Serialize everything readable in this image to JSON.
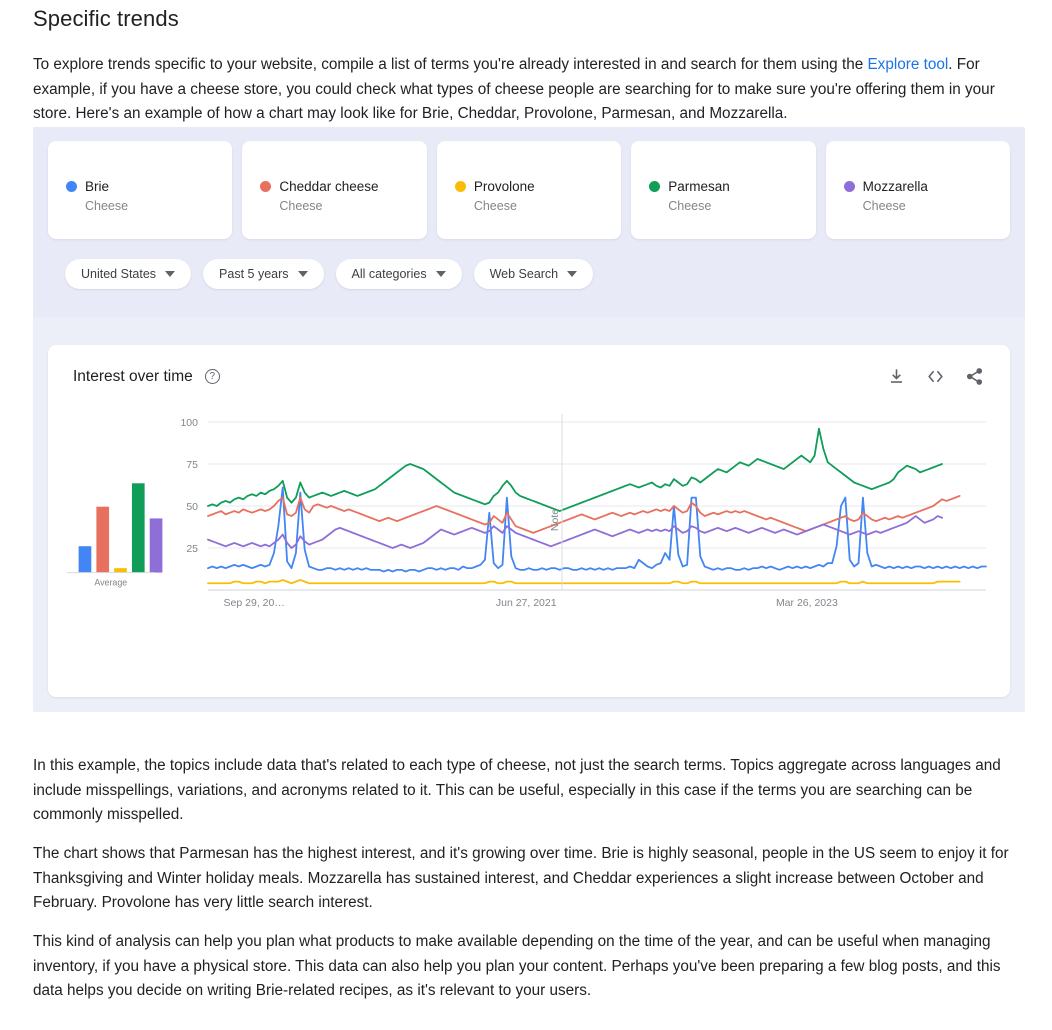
{
  "document": {
    "heading": "Specific trends",
    "paragraphs": [
      {
        "id": "p1",
        "before_link": "To explore trends specific to your website, compile a list of terms you're already interested in and search for them using the ",
        "link_text": "Explore tool",
        "after_link": ". For example, if you have a cheese store, you could check what types of cheese people are searching for to make sure you're offering them in your store. Here's an example of how a chart may look like for Brie, Cheddar, Provolone, Parmesan, and Mozzarella."
      },
      {
        "id": "p2",
        "text": "In this example, the topics include data that's related to each type of cheese, not just the search terms. Topics aggregate across languages and include misspellings, variations, and acronyms related to it. This can be useful, especially in this case if the terms you are searching can be commonly misspelled."
      },
      {
        "id": "p3",
        "text": "The chart shows that Parmesan has the highest interest, and it's growing over time. Brie is highly seasonal, people in the US seem to enjoy it for Thanksgiving and Winter holiday meals. Mozzarella has sustained interest, and Cheddar experiences a slight increase between October and February. Provolone has very little search interest."
      },
      {
        "id": "p4",
        "text": "This kind of analysis can help you plan what products to make available depending on the time of the year, and can be useful when managing inventory, if you have a physical store. This data can also help you plan your content. Perhaps you've been preparing a few blog posts, and this data helps you decide on writing Brie-related recipes, as it's relevant to your users."
      }
    ]
  },
  "trends_widget": {
    "terms": [
      {
        "name": "Brie",
        "subtitle": "Cheese",
        "color": "#4285f4"
      },
      {
        "name": "Cheddar cheese",
        "subtitle": "Cheese",
        "color": "#e8705f"
      },
      {
        "name": "Provolone",
        "subtitle": "Cheese",
        "color": "#fbbc04"
      },
      {
        "name": "Parmesan",
        "subtitle": "Cheese",
        "color": "#0f9d58"
      },
      {
        "name": "Mozzarella",
        "subtitle": "Cheese",
        "color": "#8e6fd8"
      }
    ],
    "filters": [
      {
        "label": "United States",
        "name": "region"
      },
      {
        "label": "Past 5 years",
        "name": "time-range"
      },
      {
        "label": "All categories",
        "name": "category"
      },
      {
        "label": "Web Search",
        "name": "search-type"
      }
    ],
    "chart_card": {
      "title": "Interest over time",
      "help_icon": "help-circle-icon",
      "actions": [
        {
          "name": "download-icon",
          "label": "Download"
        },
        {
          "name": "embed-code-icon",
          "label": "Embed"
        },
        {
          "name": "share-icon",
          "label": "Share"
        }
      ],
      "note_label": "Note"
    }
  },
  "chart_data": {
    "type": "line",
    "title": "Interest over time",
    "xlabel": "",
    "ylabel": "",
    "ylim": [
      0,
      100
    ],
    "yticks": [
      25,
      50,
      75,
      100
    ],
    "xticks": [
      "Sep 29, 20…",
      "Jun 27, 2021",
      "Mar 26, 2023"
    ],
    "grid": true,
    "legend_position": "top-cards",
    "annotations": [
      {
        "label": "Note",
        "x_fraction": 0.455,
        "type": "vertical-marker"
      }
    ],
    "average_chart": {
      "type": "bar",
      "title": "Average",
      "categories": [
        "Brie",
        "Cheddar cheese",
        "Provolone",
        "Parmesan",
        "Mozzarella"
      ],
      "values": [
        18,
        45,
        3,
        61,
        37
      ],
      "ylim": [
        0,
        100
      ]
    },
    "series": [
      {
        "name": "Brie",
        "color": "#4285f4",
        "values": [
          13,
          14,
          13,
          14,
          13,
          14,
          15,
          14,
          15,
          14,
          13,
          14,
          15,
          14,
          15,
          22,
          38,
          61,
          17,
          13,
          22,
          58,
          24,
          14,
          13,
          12,
          12,
          13,
          13,
          12,
          13,
          12,
          13,
          12,
          13,
          12,
          13,
          12,
          12,
          12,
          11,
          12,
          11,
          12,
          12,
          11,
          12,
          12,
          11,
          12,
          13,
          13,
          12,
          13,
          12,
          13,
          13,
          12,
          14,
          13,
          13,
          14,
          15,
          18,
          46,
          16,
          13,
          15,
          55,
          20,
          13,
          12,
          12,
          13,
          12,
          12,
          13,
          12,
          13,
          13,
          12,
          13,
          13,
          12,
          12,
          13,
          12,
          13,
          12,
          13,
          12,
          13,
          12,
          13,
          13,
          13,
          14,
          13,
          18,
          16,
          14,
          13,
          15,
          16,
          22,
          18,
          50,
          21,
          14,
          15,
          55,
          55,
          20,
          14,
          13,
          12,
          13,
          12,
          13,
          13,
          12,
          12,
          13,
          12,
          13,
          13,
          14,
          13,
          14,
          13,
          12,
          13,
          14,
          13,
          14,
          13,
          14,
          13,
          14,
          15,
          14,
          16,
          16,
          26,
          50,
          55,
          18,
          14,
          16,
          55,
          22,
          14,
          15,
          14,
          13,
          14,
          13,
          14,
          13,
          14,
          13,
          14,
          14,
          13,
          14,
          13,
          14,
          13,
          14,
          13,
          14,
          13,
          14,
          13,
          14,
          13,
          14,
          14
        ]
      },
      {
        "name": "Cheddar cheese",
        "color": "#e8705f",
        "values": [
          44,
          45,
          46,
          47,
          45,
          46,
          47,
          46,
          48,
          47,
          46,
          47,
          48,
          47,
          48,
          50,
          53,
          55,
          45,
          44,
          46,
          55,
          48,
          46,
          50,
          51,
          50,
          49,
          50,
          49,
          48,
          47,
          48,
          47,
          46,
          45,
          44,
          43,
          42,
          41,
          42,
          43,
          42,
          41,
          42,
          43,
          44,
          45,
          46,
          47,
          48,
          49,
          50,
          49,
          48,
          47,
          46,
          45,
          44,
          43,
          42,
          41,
          40,
          39,
          40,
          44,
          42,
          40,
          46,
          42,
          38,
          37,
          36,
          35,
          34,
          35,
          36,
          37,
          38,
          39,
          40,
          41,
          42,
          43,
          44,
          45,
          44,
          43,
          42,
          43,
          44,
          45,
          46,
          45,
          44,
          45,
          46,
          45,
          46,
          47,
          46,
          47,
          48,
          47,
          48,
          47,
          50,
          48,
          46,
          47,
          52,
          50,
          46,
          44,
          45,
          46,
          45,
          46,
          47,
          46,
          47,
          46,
          47,
          46,
          45,
          44,
          43,
          42,
          43,
          42,
          41,
          40,
          39,
          38,
          37,
          36,
          35,
          36,
          37,
          38,
          39,
          40,
          41,
          42,
          43,
          44,
          42,
          41,
          42,
          46,
          44,
          42,
          41,
          42,
          43,
          42,
          43,
          44,
          43,
          44,
          45,
          46,
          47,
          48,
          49,
          50,
          52,
          54,
          53,
          54,
          55,
          56
        ]
      },
      {
        "name": "Provolone",
        "color": "#fbbc04",
        "values": [
          4,
          4,
          4,
          4,
          4,
          4,
          5,
          5,
          4,
          4,
          4,
          5,
          5,
          4,
          5,
          5,
          5,
          6,
          5,
          4,
          5,
          6,
          5,
          4,
          4,
          4,
          4,
          4,
          4,
          4,
          4,
          4,
          4,
          4,
          4,
          4,
          4,
          4,
          4,
          4,
          4,
          4,
          4,
          4,
          4,
          4,
          4,
          4,
          4,
          4,
          4,
          4,
          4,
          4,
          4,
          4,
          4,
          4,
          4,
          4,
          4,
          4,
          4,
          4,
          5,
          5,
          4,
          4,
          5,
          5,
          4,
          4,
          4,
          4,
          4,
          4,
          4,
          4,
          4,
          4,
          4,
          4,
          4,
          4,
          4,
          4,
          4,
          4,
          4,
          4,
          4,
          4,
          4,
          4,
          4,
          4,
          4,
          4,
          4,
          4,
          4,
          4,
          4,
          4,
          4,
          4,
          5,
          5,
          4,
          4,
          5,
          5,
          4,
          4,
          4,
          4,
          4,
          4,
          4,
          4,
          4,
          4,
          4,
          4,
          4,
          4,
          4,
          4,
          4,
          4,
          4,
          4,
          4,
          4,
          4,
          4,
          4,
          4,
          4,
          4,
          4,
          4,
          4,
          4,
          5,
          5,
          4,
          4,
          4,
          5,
          4,
          4,
          4,
          4,
          4,
          4,
          4,
          4,
          4,
          4,
          4,
          4,
          4,
          4,
          4,
          4,
          5,
          5,
          5,
          5,
          5,
          5
        ]
      },
      {
        "name": "Parmesan",
        "color": "#0f9d58",
        "values": [
          50,
          51,
          50,
          52,
          53,
          52,
          54,
          55,
          54,
          56,
          57,
          56,
          58,
          57,
          59,
          60,
          62,
          65,
          55,
          52,
          55,
          64,
          58,
          55,
          56,
          57,
          58,
          57,
          56,
          57,
          58,
          59,
          58,
          57,
          56,
          57,
          58,
          59,
          60,
          62,
          64,
          66,
          68,
          70,
          72,
          74,
          75,
          74,
          73,
          72,
          70,
          68,
          66,
          64,
          62,
          60,
          58,
          57,
          56,
          55,
          54,
          53,
          52,
          51,
          52,
          56,
          58,
          62,
          65,
          62,
          58,
          56,
          55,
          54,
          53,
          52,
          51,
          50,
          49,
          48,
          47,
          48,
          49,
          50,
          51,
          52,
          53,
          54,
          55,
          56,
          57,
          58,
          59,
          60,
          61,
          62,
          63,
          62,
          61,
          62,
          63,
          64,
          62,
          61,
          63,
          62,
          66,
          64,
          62,
          63,
          67,
          66,
          64,
          66,
          68,
          70,
          72,
          71,
          70,
          72,
          74,
          76,
          75,
          74,
          76,
          78,
          77,
          76,
          75,
          74,
          73,
          72,
          74,
          76,
          78,
          80,
          78,
          76,
          80,
          96,
          84,
          76,
          74,
          72,
          70,
          68,
          66,
          64,
          63,
          62,
          61,
          60,
          61,
          62,
          63,
          64,
          66,
          70,
          72,
          74,
          73,
          72,
          70,
          71,
          72,
          73,
          74,
          75
        ]
      },
      {
        "name": "Mozzarella",
        "color": "#8e6fd8",
        "values": [
          30,
          29,
          28,
          27,
          26,
          27,
          28,
          27,
          26,
          27,
          28,
          27,
          26,
          27,
          26,
          28,
          30,
          33,
          28,
          25,
          27,
          32,
          29,
          27,
          28,
          29,
          30,
          32,
          34,
          36,
          37,
          36,
          35,
          34,
          33,
          32,
          31,
          30,
          29,
          28,
          27,
          26,
          25,
          26,
          27,
          26,
          25,
          26,
          27,
          28,
          30,
          32,
          34,
          36,
          35,
          34,
          33,
          34,
          35,
          36,
          37,
          36,
          35,
          34,
          35,
          38,
          36,
          34,
          38,
          36,
          34,
          33,
          32,
          31,
          30,
          29,
          28,
          27,
          26,
          27,
          28,
          29,
          30,
          31,
          32,
          33,
          34,
          35,
          36,
          35,
          34,
          33,
          32,
          33,
          34,
          35,
          36,
          35,
          34,
          35,
          36,
          35,
          36,
          35,
          36,
          35,
          38,
          36,
          34,
          35,
          38,
          37,
          35,
          34,
          35,
          36,
          37,
          36,
          35,
          36,
          37,
          36,
          35,
          34,
          35,
          36,
          37,
          36,
          35,
          34,
          35,
          36,
          35,
          34,
          33,
          34,
          35,
          36,
          37,
          38,
          39,
          38,
          37,
          36,
          35,
          34,
          33,
          34,
          35,
          34,
          33,
          34,
          35,
          34,
          35,
          36,
          37,
          38,
          39,
          40,
          42,
          44,
          42,
          40,
          41,
          42,
          44,
          43
        ]
      }
    ]
  }
}
